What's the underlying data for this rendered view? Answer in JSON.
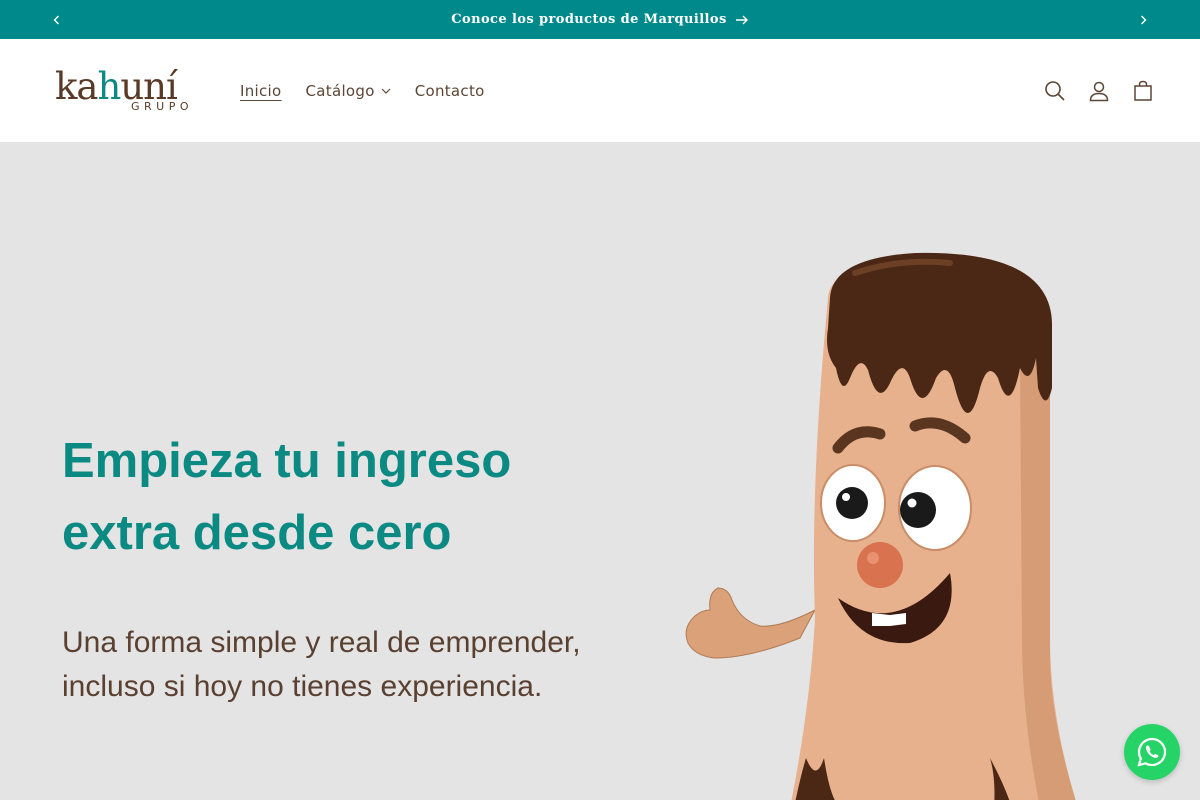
{
  "announcement": {
    "text": "Conoce los productos de Marquillos",
    "prev_icon": "chevron-left-icon",
    "next_icon": "chevron-right-icon",
    "background": "#00898a"
  },
  "logo": {
    "wordmark": "kahuní",
    "sub": "GRUPO"
  },
  "nav": {
    "items": [
      {
        "label": "Inicio",
        "active": true
      },
      {
        "label": "Catálogo",
        "has_dropdown": true
      },
      {
        "label": "Contacto"
      }
    ]
  },
  "header_icons": [
    "search-icon",
    "account-icon",
    "cart-icon"
  ],
  "hero": {
    "heading": "Empieza tu ingreso extra desde cero",
    "subheading": "Una forma simple y real de emprender, incluso si hoy no tienes experiencia.",
    "background": "#e4e4e4",
    "heading_color": "#0a8a82",
    "text_color": "#5a4030"
  },
  "floating": {
    "whatsapp_icon": "whatsapp-icon",
    "color": "#25d366"
  }
}
